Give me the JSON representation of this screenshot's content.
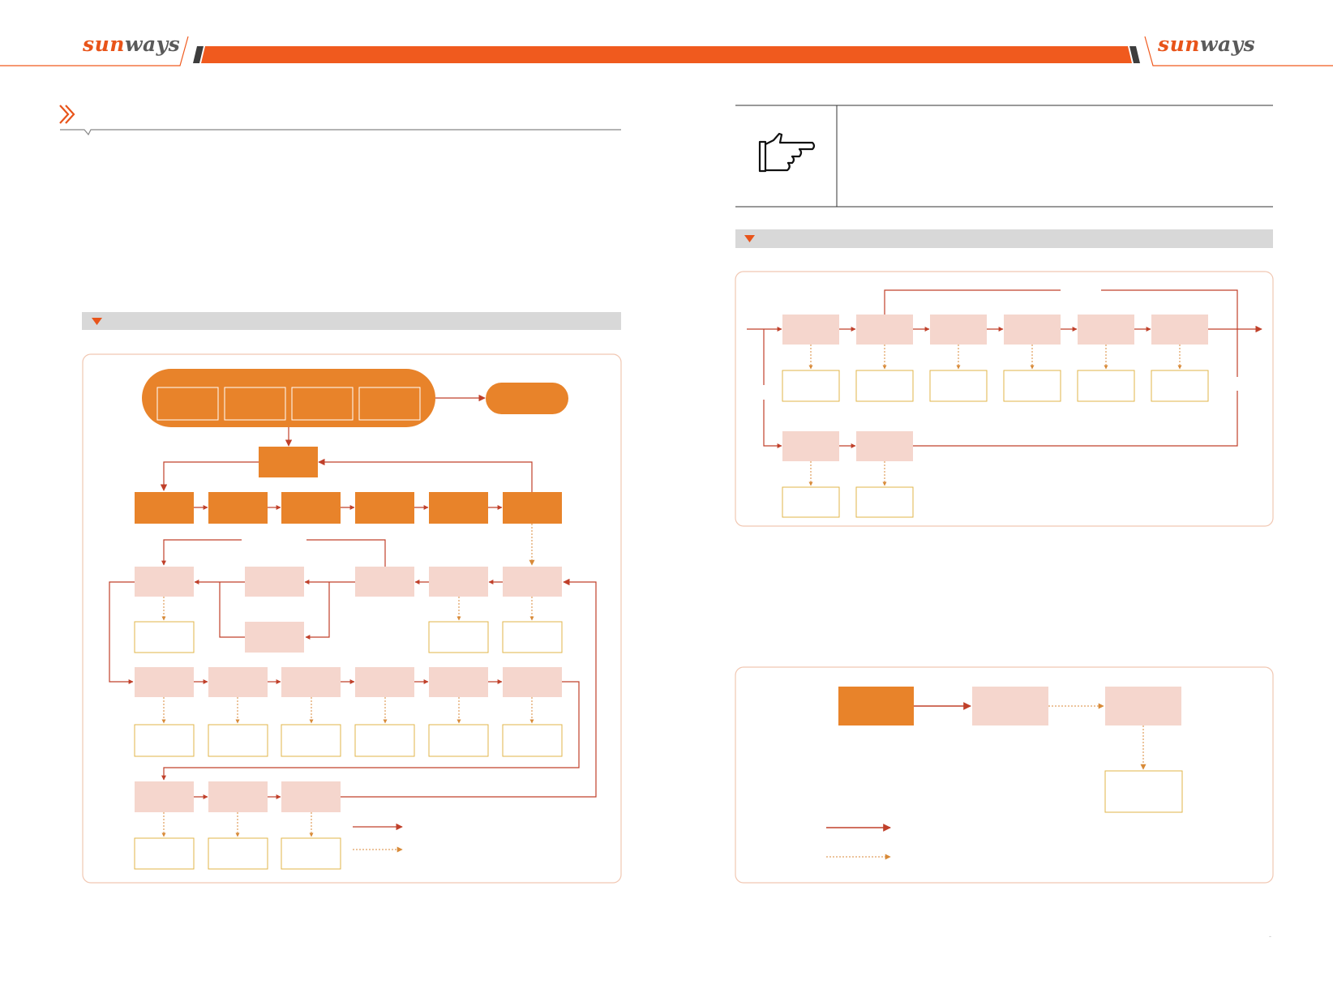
{
  "header": {
    "brand_part1": "sun",
    "brand_part2": "ways",
    "accent_color": "#f05a1e",
    "dark_color": "#3d3d3d"
  },
  "icons": {
    "section_marker": "double-chevron-right-icon",
    "note": "pointing-hand-icon",
    "figure_marker": "triangle-down-icon"
  },
  "colors": {
    "orange_solid": "#e8832a",
    "pink_box": "#f5d6cd",
    "gold_border": "#e2b649",
    "red_line": "#c0402a",
    "dotted_line": "#d88a38",
    "panel_border": "#f1c7b2",
    "caption_bar": "#d8d8d8"
  },
  "page": {
    "number": "-"
  }
}
